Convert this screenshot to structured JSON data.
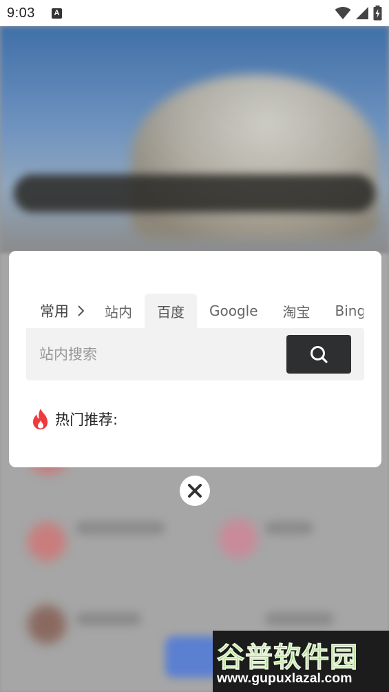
{
  "status_bar": {
    "time": "9:03",
    "notification_letter": "A"
  },
  "search_panel": {
    "category_label": "常用",
    "tabs": [
      {
        "label": "站内",
        "active": false
      },
      {
        "label": "百度",
        "active": true
      },
      {
        "label": "Google",
        "active": false
      },
      {
        "label": "淘宝",
        "active": false
      },
      {
        "label": "Bing",
        "active": false
      }
    ],
    "search_placeholder": "站内搜索",
    "hot_label": "热门推荐:"
  },
  "watermark": {
    "name": "谷普软件园",
    "url": "www.gupuxlazal.com"
  },
  "colors": {
    "search_button": "#2d2f31",
    "active_tab_bg": "#f2f2f2",
    "fire_icon": "#ee3b3b",
    "watermark_green": "#7fc94b"
  }
}
